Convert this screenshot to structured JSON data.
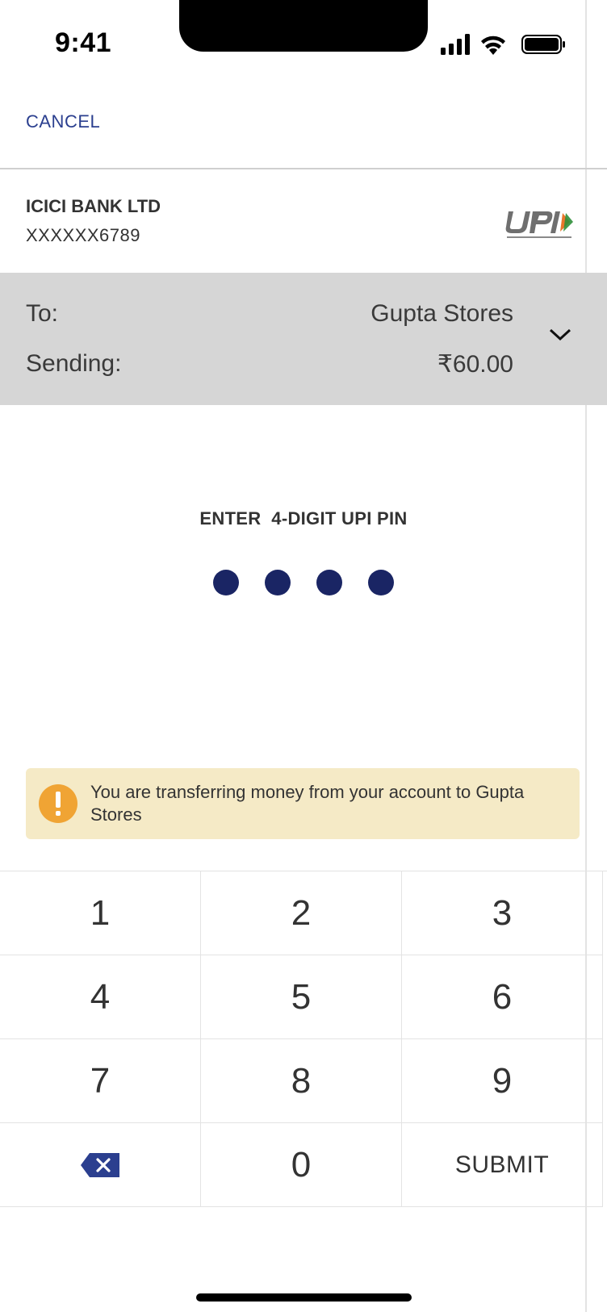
{
  "status_bar": {
    "time": "9:41",
    "icons": [
      "cellular-signal-icon",
      "wifi-icon",
      "battery-icon"
    ]
  },
  "header": {
    "cancel_label": "CANCEL"
  },
  "bank": {
    "name": "ICICI BANK LTD",
    "account": "XXXXXX6789",
    "logo": "upi-logo"
  },
  "details": {
    "to_label": "To:",
    "to_value": "Gupta Stores",
    "sending_label": "Sending:",
    "sending_value": "₹60.00",
    "expand_icon": "chevron-down-icon"
  },
  "pin": {
    "title": "ENTER  4-DIGIT UPI PIN",
    "digits_entered": 4,
    "dot_color": "#1a2564"
  },
  "warning": {
    "icon": "exclamation-icon",
    "text": "You are transferring money from your account to Gupta Stores",
    "background": "#f5eac6",
    "icon_color": "#f0a434"
  },
  "keypad": {
    "keys": [
      "1",
      "2",
      "3",
      "4",
      "5",
      "6",
      "7",
      "8",
      "9",
      "",
      "0",
      "SUBMIT"
    ],
    "backspace_icon": "backspace-icon"
  },
  "colors": {
    "accent": "#2b3f8f",
    "panel": "#d6d6d6"
  }
}
